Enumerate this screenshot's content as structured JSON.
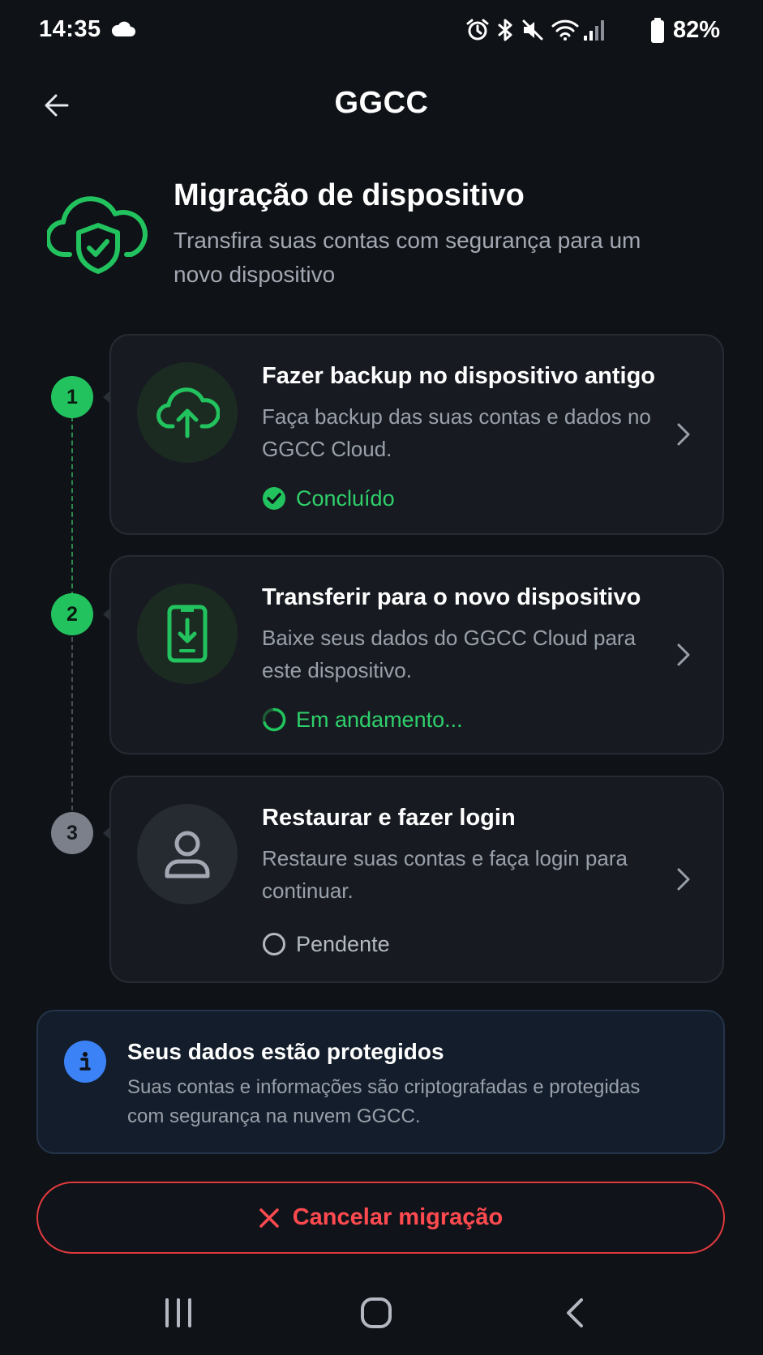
{
  "status_bar": {
    "time": "14:35",
    "battery": "82%",
    "icons": [
      "cloud-icon",
      "alarm-icon",
      "bluetooth-icon",
      "mute-icon",
      "wifi-icon",
      "signal-icon",
      "battery-icon"
    ]
  },
  "header": {
    "title": "GGCC",
    "back_icon": "arrow-left-icon"
  },
  "intro": {
    "title": "Migração de dispositivo",
    "subtitle": "Transfira suas contas com segurança para um novo dispositivo",
    "icon": "cloud-shield-check-icon"
  },
  "steps": [
    {
      "number": "1",
      "title": "Fazer backup no dispositivo antigo",
      "description": "Faça backup das suas contas e dados no GGCC Cloud.",
      "status": "Concluído",
      "icon": "cloud-upload-icon"
    },
    {
      "number": "2",
      "title": "Transferir para o novo dispositivo",
      "description": "Baixe seus dados do GGCC Cloud para este dispositivo.",
      "status": "Em andamento...",
      "icon": "phone-download-icon"
    },
    {
      "number": "3",
      "title": "Restaurar e fazer login",
      "description": "Restaure suas contas e faça login para continuar.",
      "status": "Pendente",
      "icon": "user-icon"
    }
  ],
  "info": {
    "title": "Seus dados estão protegidos",
    "text": "Suas contas e informações são criptografadas e protegidas com segurança na nuvem GGCC."
  },
  "cancel_button": {
    "label": "Cancelar migração"
  },
  "colors": {
    "background": "#0f1217",
    "accent_green": "#22c35e",
    "danger_red": "#ff4a4f",
    "info_blue": "#3b82f6"
  }
}
